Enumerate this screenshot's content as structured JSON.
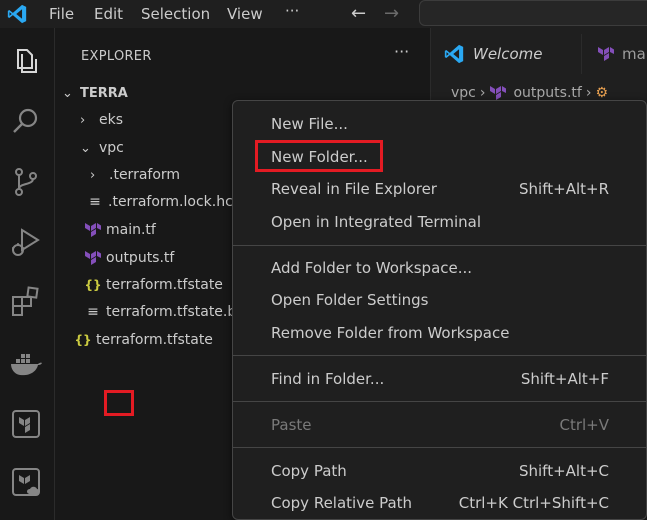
{
  "menubar": {
    "items": [
      "File",
      "Edit",
      "Selection",
      "View"
    ],
    "more": "···",
    "back_arrow": "←",
    "forward_arrow": "→"
  },
  "activity": {
    "icons": [
      "explorer-icon",
      "search-icon",
      "source-control-icon",
      "run-debug-icon",
      "extensions-icon",
      "docker-icon",
      "terraform-icon",
      "terraform-cloud-icon"
    ]
  },
  "explorer": {
    "header": "EXPLORER",
    "more": "···",
    "root": "TERRA",
    "items": [
      {
        "label": "eks",
        "chevron": "›",
        "icon": ""
      },
      {
        "label": "vpc",
        "chevron": "⌄",
        "icon": ""
      },
      {
        "label": ".terraform",
        "chevron": "›",
        "icon": ""
      },
      {
        "label": ".terraform.lock.hcl",
        "chevron": "",
        "icon": "≡"
      },
      {
        "label": "main.tf",
        "chevron": "",
        "icon": "terraform"
      },
      {
        "label": "outputs.tf",
        "chevron": "",
        "icon": "terraform"
      },
      {
        "label": "terraform.tfstate",
        "chevron": "",
        "icon": "{}"
      },
      {
        "label": "terraform.tfstate.backup",
        "chevron": "",
        "icon": "≡"
      },
      {
        "label": "terraform.tfstate",
        "chevron": "",
        "icon": "{}"
      }
    ]
  },
  "editor": {
    "tabs": [
      {
        "label": "Welcome"
      },
      {
        "label": "main"
      }
    ],
    "breadcrumb": {
      "folder": "vpc",
      "sep": "›",
      "file": "outputs.tf"
    }
  },
  "context_menu": {
    "groups": [
      [
        {
          "label": "New File...",
          "shortcut": ""
        },
        {
          "label": "New Folder...",
          "shortcut": ""
        },
        {
          "label": "Reveal in File Explorer",
          "shortcut": "Shift+Alt+R"
        },
        {
          "label": "Open in Integrated Terminal",
          "shortcut": ""
        }
      ],
      [
        {
          "label": "Add Folder to Workspace...",
          "shortcut": ""
        },
        {
          "label": "Open Folder Settings",
          "shortcut": ""
        },
        {
          "label": "Remove Folder from Workspace",
          "shortcut": ""
        }
      ],
      [
        {
          "label": "Find in Folder...",
          "shortcut": "Shift+Alt+F"
        }
      ],
      [
        {
          "label": "Paste",
          "shortcut": "Ctrl+V",
          "disabled": true
        }
      ],
      [
        {
          "label": "Copy Path",
          "shortcut": "Shift+Alt+C"
        },
        {
          "label": "Copy Relative Path",
          "shortcut": "Ctrl+K Ctrl+Shift+C"
        }
      ]
    ]
  },
  "colors": {
    "accent": "#0078d4",
    "terraform": "#844fba",
    "json": "#cbcb41",
    "highlight": "#e31b23"
  }
}
